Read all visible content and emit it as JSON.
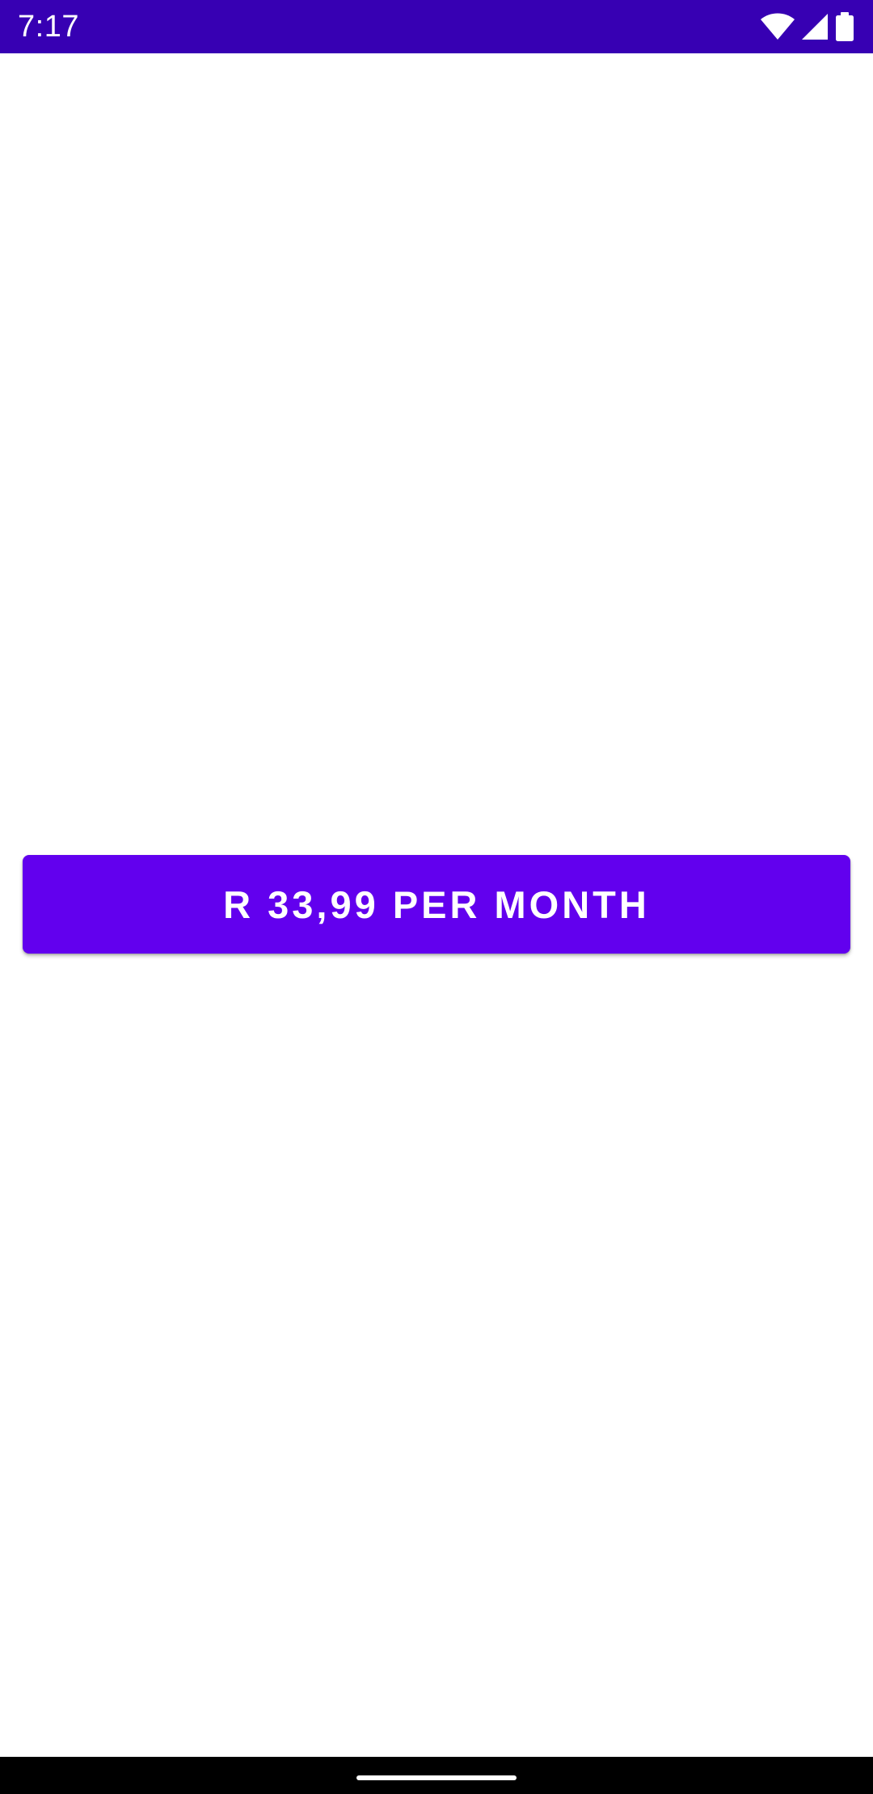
{
  "status_bar": {
    "time": "7:17",
    "background_color": "#3700b3",
    "icons": [
      "wifi-icon",
      "cellular-signal-icon",
      "battery-icon"
    ]
  },
  "main": {
    "price_button_label": "R 33,99 PER MONTH",
    "button_color": "#6200ee"
  },
  "navigation_bar": {
    "handle": "home-gesture-handle"
  }
}
